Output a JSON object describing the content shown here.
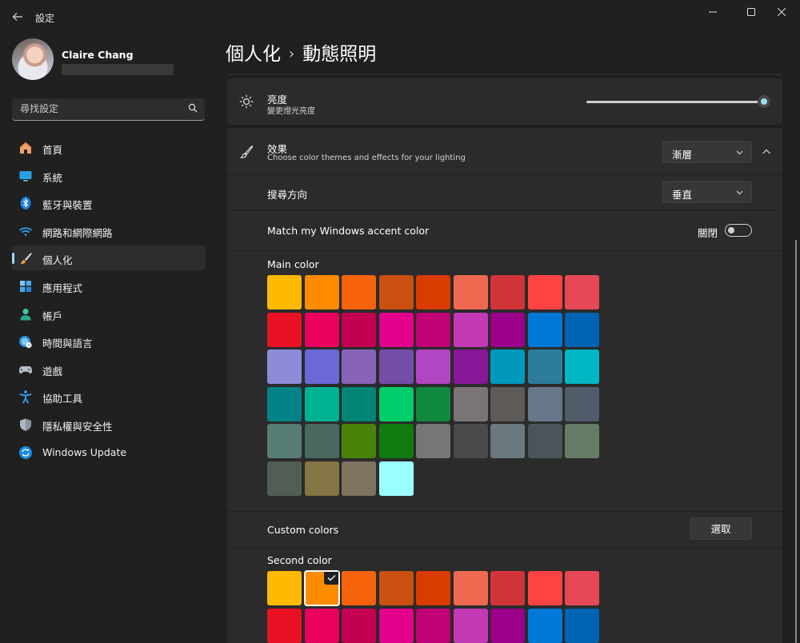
{
  "window": {
    "title": "設定"
  },
  "profile": {
    "name": "Claire Chang"
  },
  "search": {
    "placeholder": "尋找設定"
  },
  "nav": [
    {
      "label": "首頁",
      "icon": "home-icon"
    },
    {
      "label": "系統",
      "icon": "system-icon"
    },
    {
      "label": "藍牙與裝置",
      "icon": "bluetooth-icon"
    },
    {
      "label": "網路和網際網路",
      "icon": "wifi-icon"
    },
    {
      "label": "個人化",
      "icon": "paintbrush-icon",
      "active": true
    },
    {
      "label": "應用程式",
      "icon": "apps-icon"
    },
    {
      "label": "帳戶",
      "icon": "account-icon"
    },
    {
      "label": "時間與語言",
      "icon": "time-language-icon"
    },
    {
      "label": "遊戲",
      "icon": "gamepad-icon"
    },
    {
      "label": "協助工具",
      "icon": "accessibility-icon"
    },
    {
      "label": "隱私權與安全性",
      "icon": "shield-icon"
    },
    {
      "label": "Windows Update",
      "icon": "windows-update-icon"
    }
  ],
  "breadcrumb": {
    "parent": "個人化",
    "separator": "›",
    "current": "動態照明"
  },
  "brightness": {
    "title": "亮度",
    "subtitle": "變更燈光亮度",
    "value": 1.0
  },
  "effects": {
    "title": "效果",
    "subtitle": "Choose color themes and effects for your lighting",
    "value": "漸層",
    "expanded": true
  },
  "direction": {
    "title": "搜尋方向",
    "value": "垂直"
  },
  "accent": {
    "title": "Match my Windows accent color",
    "state_label": "關閉",
    "on": false
  },
  "main_color": {
    "title": "Main color",
    "selected_index": 49,
    "colors": [
      "#FFB900",
      "#FF8C00",
      "#F7630C",
      "#CA5010",
      "#DA3B01",
      "#EF6950",
      "#D13438",
      "#FF4343",
      "#E74856",
      "#E81123",
      "#EA005E",
      "#C30052",
      "#E3008C",
      "#BF0077",
      "#C239B3",
      "#9A0089",
      "#0078D7",
      "#0063B1",
      "#8E8CD8",
      "#6B69D6",
      "#8764B8",
      "#744DA9",
      "#B146C2",
      "#881798",
      "#0099BC",
      "#2D7D9A",
      "#00B7C3",
      "#038387",
      "#00B294",
      "#018574",
      "#00CC6A",
      "#10893E",
      "#7A7574",
      "#5D5A58",
      "#68768A",
      "#515C6B",
      "#567C73",
      "#486860",
      "#498205",
      "#107C10",
      "#767676",
      "#4C4A48",
      "#69797E",
      "#4A5459",
      "#647C64",
      "#525E54",
      "#847545",
      "#7E735F",
      "#9BFFFF"
    ]
  },
  "custom_colors": {
    "title": "Custom colors",
    "button_label": "選取"
  },
  "second_color": {
    "title": "Second color",
    "selected_index": 1,
    "colors": [
      "#FFB900",
      "#FF8C00",
      "#F7630C",
      "#CA5010",
      "#DA3B01",
      "#EF6950",
      "#D13438",
      "#FF4343",
      "#E74856",
      "#E81123",
      "#EA005E",
      "#C30052",
      "#E3008C",
      "#BF0077",
      "#C239B3",
      "#9A0089",
      "#0078D7",
      "#0063B1"
    ]
  },
  "colors": {
    "background": "#202020",
    "card": "#2B2B2B",
    "accent": "#9BDCF1"
  }
}
